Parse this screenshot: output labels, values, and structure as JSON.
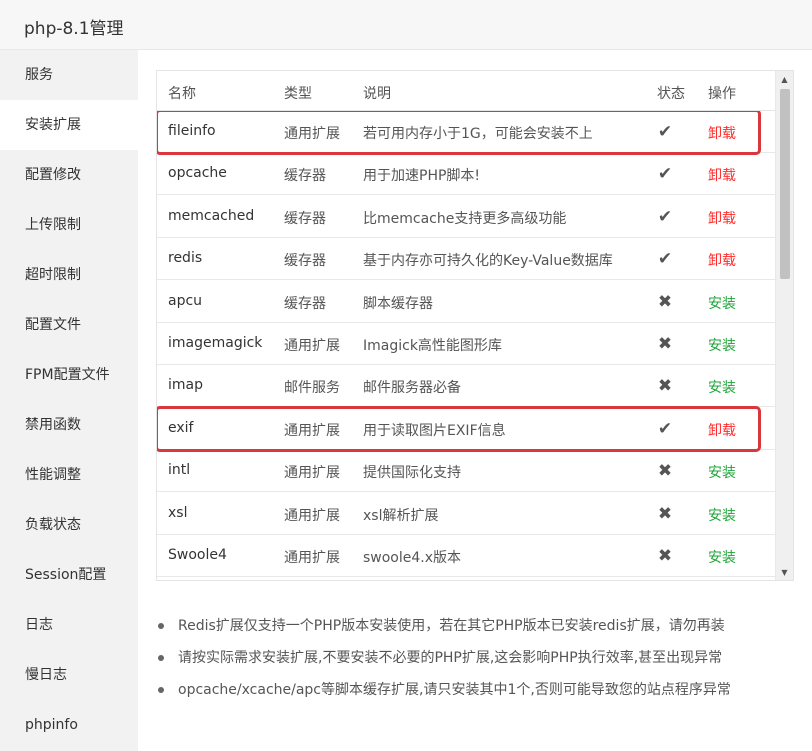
{
  "window": {
    "title": "php-8.1管理"
  },
  "sidebar": {
    "items": [
      {
        "label": "服务"
      },
      {
        "label": "安装扩展"
      },
      {
        "label": "配置修改"
      },
      {
        "label": "上传限制"
      },
      {
        "label": "超时限制"
      },
      {
        "label": "配置文件"
      },
      {
        "label": "FPM配置文件"
      },
      {
        "label": "禁用函数"
      },
      {
        "label": "性能调整"
      },
      {
        "label": "负载状态"
      },
      {
        "label": "Session配置"
      },
      {
        "label": "日志"
      },
      {
        "label": "慢日志"
      },
      {
        "label": "phpinfo"
      }
    ],
    "active_index": 1
  },
  "table": {
    "headers": {
      "name": "名称",
      "type": "类型",
      "desc": "说明",
      "status": "状态",
      "op": "操作"
    },
    "rows": [
      {
        "name": "fileinfo",
        "type": "通用扩展",
        "desc": "若可用内存小于1G，可能会安装不上",
        "status": "✔",
        "op": "卸载",
        "installed": true,
        "highlighted": true
      },
      {
        "name": "opcache",
        "type": "缓存器",
        "desc": "用于加速PHP脚本!",
        "status": "✔",
        "op": "卸载",
        "installed": true
      },
      {
        "name": "memcached",
        "type": "缓存器",
        "desc": "比memcache支持更多高级功能",
        "status": "✔",
        "op": "卸载",
        "installed": true
      },
      {
        "name": "redis",
        "type": "缓存器",
        "desc": "基于内存亦可持久化的Key-Value数据库",
        "status": "✔",
        "op": "卸载",
        "installed": true
      },
      {
        "name": "apcu",
        "type": "缓存器",
        "desc": "脚本缓存器",
        "status": "✖",
        "op": "安装",
        "installed": false
      },
      {
        "name": "imagemagick",
        "type": "通用扩展",
        "desc": "Imagick高性能图形库",
        "status": "✖",
        "op": "安装",
        "installed": false
      },
      {
        "name": "imap",
        "type": "邮件服务",
        "desc": "邮件服务器必备",
        "status": "✖",
        "op": "安装",
        "installed": false
      },
      {
        "name": "exif",
        "type": "通用扩展",
        "desc": "用于读取图片EXIF信息",
        "status": "✔",
        "op": "卸载",
        "installed": true,
        "highlighted": true
      },
      {
        "name": "intl",
        "type": "通用扩展",
        "desc": "提供国际化支持",
        "status": "✖",
        "op": "安装",
        "installed": false
      },
      {
        "name": "xsl",
        "type": "通用扩展",
        "desc": "xsl解析扩展",
        "status": "✖",
        "op": "安装",
        "installed": false
      },
      {
        "name": "Swoole4",
        "type": "通用扩展",
        "desc": "swoole4.x版本",
        "status": "✖",
        "op": "安装",
        "installed": false
      }
    ]
  },
  "notes": [
    "Redis扩展仅支持一个PHP版本安装使用，若在其它PHP版本已安装redis扩展，请勿再装",
    "请按实际需求安装扩展,不要安装不必要的PHP扩展,这会影响PHP执行效率,甚至出现异常",
    "opcache/xcache/apc等脚本缓存扩展,请只安装其中1个,否则可能导致您的站点程序异常"
  ],
  "colors": {
    "uninstall": "#ff2d2d",
    "install": "#20a53a",
    "highlight_border": "#d9363e",
    "sidebar_bg": "#f2f2f2"
  },
  "icons": {
    "installed": "check-icon",
    "not_installed": "cross-icon",
    "scroll_up": "arrow-up-icon",
    "scroll_down": "arrow-down-icon"
  }
}
